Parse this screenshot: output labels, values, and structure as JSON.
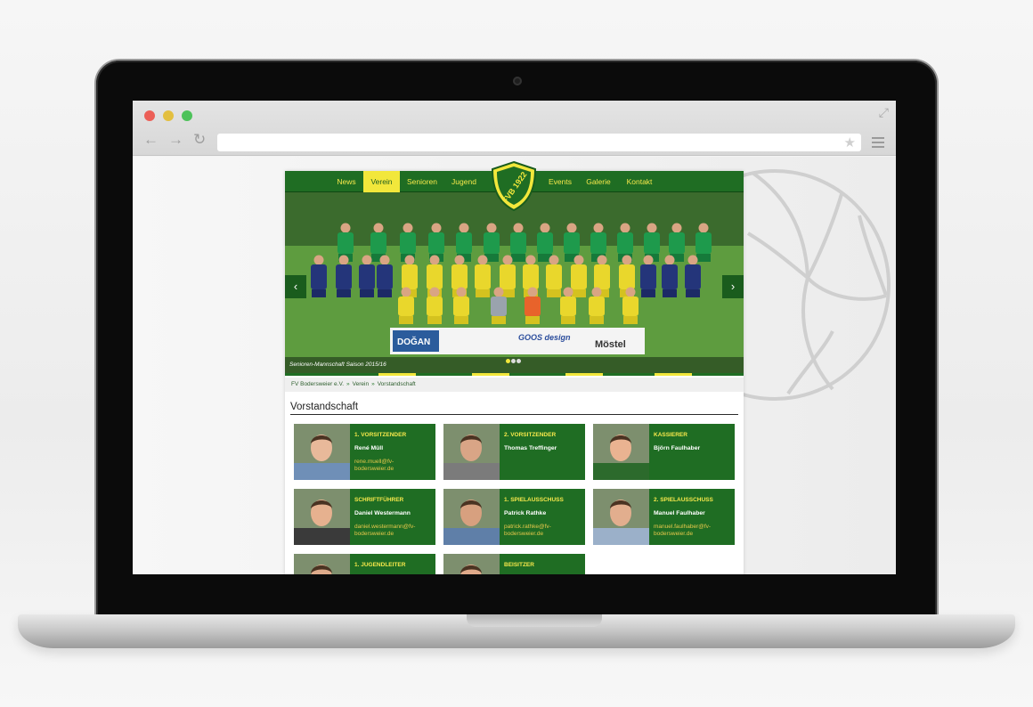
{
  "browser": {
    "url": ""
  },
  "nav": {
    "left": [
      "News",
      "Verein",
      "Senioren",
      "Jugend"
    ],
    "right": [
      "Events",
      "Galerie",
      "Kontakt"
    ],
    "active": "Verein"
  },
  "crest": {
    "text": "FVB 1922"
  },
  "hero": {
    "caption": "Senioren-Mannschaft Saison 2015/16",
    "prev_arrow": "‹",
    "next_arrow": "›",
    "sponsors": [
      "DOĞAN",
      "GOOS design",
      "Möstel"
    ]
  },
  "breadcrumb": [
    "FV Bodersweier e.V.",
    "Verein",
    "Vorstandschaft"
  ],
  "page_title": "Vorstandschaft",
  "members": [
    {
      "role": "1. VORSITZENDER",
      "name": "René Müll",
      "email": "rene.muell@fv-bodersweier.de"
    },
    {
      "role": "2. VORSITZENDER",
      "name": "Thomas Treffinger",
      "email": ""
    },
    {
      "role": "KASSIERER",
      "name": "Björn Faulhaber",
      "email": ""
    },
    {
      "role": "SCHRIFTFÜHRER",
      "name": "Daniel Westermann",
      "email": "daniel.westermann@fv-bodersweier.de"
    },
    {
      "role": "1. SPIELAUSSCHUSS",
      "name": "Patrick Rathke",
      "email": "patrick.rathke@fv-bodersweier.de"
    },
    {
      "role": "2. SPIELAUSSCHUSS",
      "name": "Manuel Faulhaber",
      "email": "manuel.faulhaber@fv-bodersweier.de"
    },
    {
      "role": "1. JUGENDLEITER",
      "name": "",
      "email": ""
    },
    {
      "role": "BEISITZER",
      "name": "",
      "email": ""
    }
  ],
  "colors": {
    "green": "#1f6d23",
    "yellow": "#f2e73b"
  }
}
